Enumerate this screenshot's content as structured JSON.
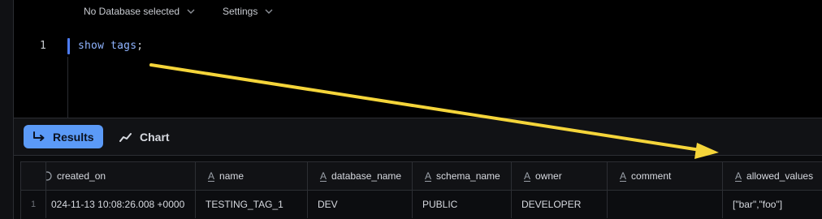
{
  "toolbar": {
    "database_selector": "No Database selected",
    "settings": "Settings"
  },
  "editor": {
    "line_number": "1",
    "code_keyword": "show tags",
    "code_punct": ";"
  },
  "result_tabs": {
    "results_label": "Results",
    "chart_label": "Chart",
    "active": "Results"
  },
  "table": {
    "columns": [
      {
        "label": "created_on",
        "type_icon": "clock-icon"
      },
      {
        "label": "name",
        "type_icon": "text-type-icon"
      },
      {
        "label": "database_name",
        "type_icon": "text-type-icon"
      },
      {
        "label": "schema_name",
        "type_icon": "text-type-icon"
      },
      {
        "label": "owner",
        "type_icon": "text-type-icon"
      },
      {
        "label": "comment",
        "type_icon": "text-type-icon"
      },
      {
        "label": "allowed_values",
        "type_icon": "text-type-icon"
      }
    ],
    "type_glyph": "A",
    "rows": [
      {
        "index": "1",
        "created_on": "024-11-13 10:08:26.008 +0000",
        "name": "TESTING_TAG_1",
        "database_name": "DEV",
        "schema_name": "PUBLIC",
        "owner": "DEVELOPER",
        "comment": "",
        "allowed_values": "[\"bar\",\"foo\"]"
      }
    ]
  },
  "annotation": {
    "color": "#f5d53a"
  },
  "colors": {
    "accent": "#5b9af7",
    "cursor": "#4d7cf5",
    "code": "#8fb4ff",
    "background": "#000000"
  }
}
